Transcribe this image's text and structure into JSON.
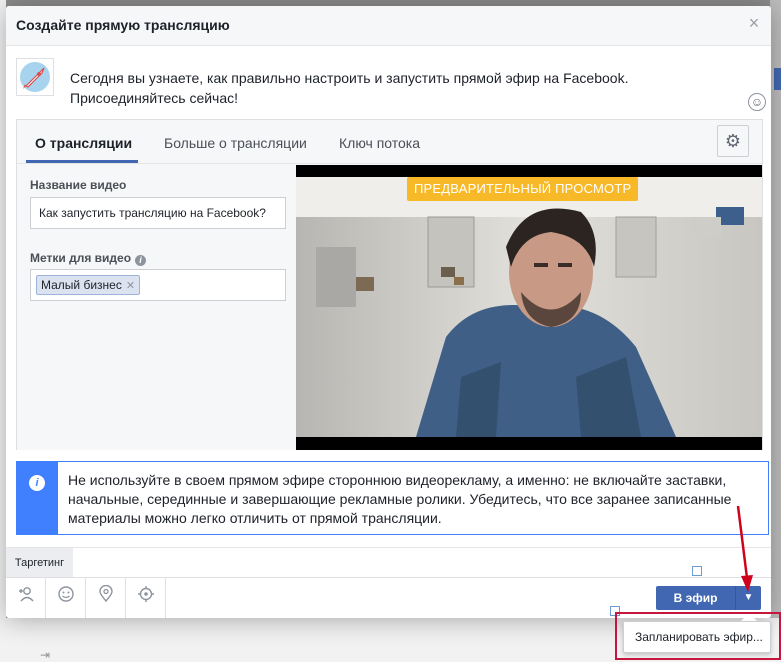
{
  "dialog": {
    "title": "Создайте прямую трансляцию",
    "close_glyph": "×"
  },
  "intro": {
    "text": "Сегодня вы узнаете, как правильно настроить и запустить прямой эфир на Facebook. Присоединяйтесь сейчас!"
  },
  "tabs": [
    {
      "label": "О трансляции",
      "active": true
    },
    {
      "label": "Больше о трансляции",
      "active": false
    },
    {
      "label": "Ключ потока",
      "active": false
    }
  ],
  "form": {
    "video_title_label": "Название видео",
    "video_title_value": "Как запустить трансляцию на Facebook?",
    "tags_label": "Метки для видео",
    "tags": [
      "Малый бизнес"
    ]
  },
  "preview": {
    "badge": "ПРЕДВАРИТЕЛЬНЫЙ ПРОСМОТР"
  },
  "notice": {
    "text": "Не используйте в своем прямом эфире стороннюю видеорекламу, а именно: не включайте заставки, начальные, серединные и завершающие рекламные ролики. Убедитесь, что все заранее записанные материалы можно легко отличить от прямой трансляции."
  },
  "targeting": {
    "tab_label": "Таргетинг"
  },
  "footer": {
    "tools": [
      "tag-people-icon",
      "feeling-icon",
      "location-icon",
      "target-icon"
    ],
    "go_live_label": "В эфир"
  },
  "dropdown": {
    "item_label": "Запланировать эфир..."
  },
  "colors": {
    "accent": "#4267b2",
    "notice_blue": "#4080ff",
    "badge_yellow": "#f7b928",
    "highlight_red": "#c5173d"
  }
}
